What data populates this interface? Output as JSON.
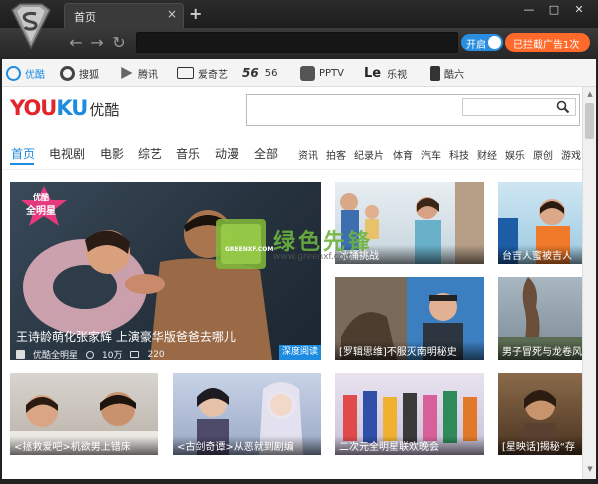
{
  "browser": {
    "tab_label": "首页",
    "tab_close": "×",
    "new_tab": "+",
    "minimize": "—",
    "maximize": "□",
    "close": "✕",
    "back": "←",
    "forward": "→",
    "reload": "↻",
    "toggle_label": "开启",
    "adblock_label": "已拦截广告1次"
  },
  "bookmarks": [
    {
      "label": "优酷",
      "color": "#1c8be0"
    },
    {
      "label": "搜狐",
      "color": "#444444"
    },
    {
      "label": "腾讯",
      "color": "#555555"
    },
    {
      "label": "爱奇艺",
      "color": "#333333"
    },
    {
      "label": "56",
      "color": "#333333"
    },
    {
      "label": "PPTV",
      "color": "#555555"
    },
    {
      "label": "乐视",
      "color": "#222222"
    },
    {
      "label": "酷六",
      "color": "#333333"
    }
  ],
  "youku": {
    "logo_you": "YOU",
    "logo_ku": "KU",
    "logo_cn": "优酷"
  },
  "channels_main": [
    "首页",
    "电视剧",
    "电影",
    "综艺",
    "音乐",
    "动漫",
    "全部"
  ],
  "channels_sub": [
    "资讯",
    "拍客",
    "纪录片",
    "体育",
    "汽车",
    "科技",
    "财经",
    "娱乐",
    "原创",
    "游戏"
  ],
  "featured": {
    "badge": "全明星",
    "badge_top": "优酷",
    "title": "王诗龄萌化张家辉 上演豪华版爸爸去哪儿",
    "channel": "优酷全明星",
    "views": "10万",
    "comments": "220",
    "tag": "深度阅读"
  },
  "cards": [
    {
      "caption": "冰桶挑战"
    },
    {
      "caption": "台吉人蜜被吉人"
    },
    {
      "caption": "[罗辑思维]不服灭南明秘史"
    },
    {
      "caption": "男子冒死与龙卷风"
    },
    {
      "caption": "<拯救爱吧>机欲男上错床"
    },
    {
      "caption": "<古剑奇谭>从恶就到剧编"
    },
    {
      "caption": "二次元全明星联欢晚会"
    },
    {
      "caption": "[星映话]揭秘“存"
    }
  ],
  "watermark": {
    "title": "绿色先锋",
    "sub": "GREENXF.COM",
    "url": "www.greenxf.com"
  },
  "colors": {
    "accent": "#1c8be0",
    "brand_red": "#e0262b",
    "adblock": "#ff6a2a"
  }
}
